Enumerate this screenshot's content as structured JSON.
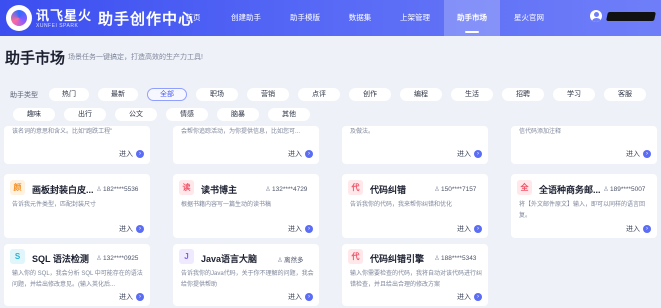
{
  "header": {
    "logo_name": "讯飞星火",
    "logo_sub": "XUNFEI SPARK",
    "title": "助手创作中心",
    "nav": [
      {
        "label": "首页"
      },
      {
        "label": "创建助手"
      },
      {
        "label": "助手模版"
      },
      {
        "label": "数据集"
      },
      {
        "label": "上架管理"
      },
      {
        "label": "助手市场"
      },
      {
        "label": "星火官网"
      }
    ],
    "active_nav": "助手市场"
  },
  "page": {
    "title": "助手市场",
    "subtitle": "场景任务一键搞定，打造高效的生产力工具!"
  },
  "filters": {
    "label": "助手类型",
    "chips": [
      "热门",
      "最新",
      "全部",
      "职场",
      "营销",
      "点评",
      "创作",
      "编程",
      "生活",
      "招聘",
      "学习",
      "客服",
      "趣味",
      "出行",
      "公文",
      "情感",
      "脑暴",
      "其他"
    ],
    "selected": "全部"
  },
  "cards_partial": [
    {
      "desc": "该名词的意思和含义。比如\"跑跌工程\"",
      "enter": "进入"
    },
    {
      "desc": "会帮你追踪活动，为你提供信息，比如您可...",
      "enter": "进入"
    },
    {
      "desc": "及做法。",
      "enter": "进入"
    },
    {
      "desc": "信代码添加注释",
      "enter": "进入"
    }
  ],
  "cards": [
    {
      "icon": "颜",
      "title": "画板封装白皮...",
      "author": "182****5536",
      "desc": "告诉我元件类型，匹配封装尺寸",
      "enter": "进入"
    },
    {
      "icon": "读",
      "title": "读书博主",
      "author": "132****4729",
      "desc": "根据书籍内容写一篇生动的读书稿",
      "enter": "进入"
    },
    {
      "icon": "代",
      "title": "代码纠错",
      "author": "150****7157",
      "desc": "告诉我你的代码，我来帮你纠错和优化",
      "enter": "进入"
    },
    {
      "icon": "全",
      "title": "全语种商务邮...",
      "author": "189****5007",
      "desc": "将【外文邮件原文】输入，即可以同样的语言回复。",
      "enter": "进入"
    },
    {
      "icon": "S",
      "title": "SQL 语法检测",
      "author": "132****0925",
      "desc": "输入你的 SQL，我会分析 SQL 中可能存在的语法问题，并给出修改意见。(输入英化后...",
      "enter": "进入"
    },
    {
      "icon": "J",
      "title": "Java语言大脑",
      "author": "离然多",
      "desc": "告诉我你的Java代码，关于你不理解的问题，我会给你提供帮助",
      "enter": "进入"
    },
    {
      "icon": "代",
      "title": "代码纠错引擎",
      "author": "188****5343",
      "desc": "输入你需要检查的代码，我将自动对该代码进行纠错检查，并且给出合理的修改方案",
      "enter": "进入"
    }
  ],
  "colors": {
    "brand": "#4a5cf2",
    "background": "#eef1f8",
    "accent": "#5b6cf5"
  }
}
